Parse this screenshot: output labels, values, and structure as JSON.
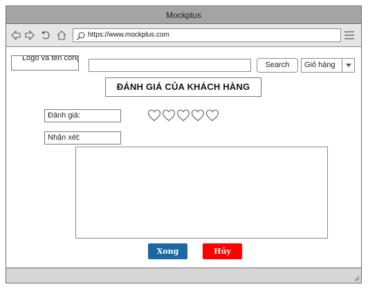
{
  "window": {
    "title": "Mockplus"
  },
  "browser": {
    "url": "https://www.mockplus.com",
    "nav_icons": [
      "back-arrow-icon",
      "forward-arrow-icon",
      "refresh-icon",
      "home-icon"
    ],
    "menu_icon": "hamburger-menu-icon"
  },
  "header": {
    "logo_text": "Logo và tên công ty",
    "search_value": "",
    "search_button": "Search",
    "cart_select_value": "Giỏ hàng"
  },
  "main": {
    "heading": "ĐÁNH GIÁ CỦA KHÁCH HÀNG",
    "rating_label": "Đánh giá:",
    "rating": {
      "value": 0,
      "max": 5,
      "icon": "heart-outline-icon"
    },
    "comment_label": "Nhận xét:",
    "comment_value": ""
  },
  "actions": {
    "done_label": "Xong",
    "cancel_label": "Hủy"
  },
  "colors": {
    "done_button": "#1b69a4",
    "cancel_button": "#ff0000",
    "titlebar": "#a4a4a4",
    "toolbar": "#e6e6e6"
  }
}
